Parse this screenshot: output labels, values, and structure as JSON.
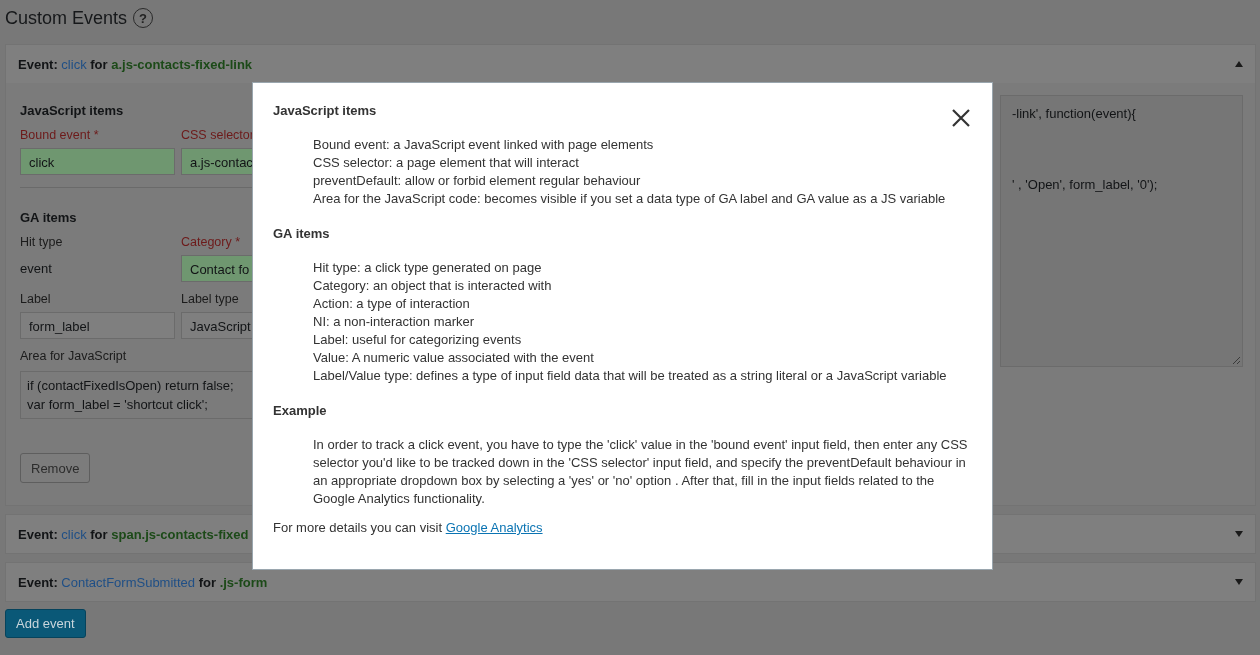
{
  "page_title": "Custom Events",
  "help_label": "?",
  "events": [
    {
      "prefix": "Event:",
      "event_type": "click",
      "joiner": "for",
      "selector": "a.js-contacts-fixed-link",
      "expanded": true,
      "body": {
        "js_section": {
          "heading": "JavaScript items",
          "fields": [
            {
              "label": "Bound event *",
              "required": true,
              "kind": "input",
              "value": "click",
              "valid": true
            },
            {
              "label": "CSS selector",
              "required": true,
              "kind": "input",
              "value": "a.js-contac",
              "valid": true
            }
          ]
        },
        "ga_section": {
          "heading": "GA items",
          "rows": [
            [
              {
                "label": "Hit type",
                "required": false,
                "kind": "text",
                "value": "event"
              },
              {
                "label": "Category *",
                "required": true,
                "kind": "input",
                "value": "Contact fo",
                "valid": true
              }
            ],
            [
              {
                "label": "Label",
                "required": false,
                "kind": "input",
                "value": "form_label",
                "valid": false
              },
              {
                "label": "Label type",
                "required": false,
                "kind": "input",
                "value": "JavaScript",
                "valid": false
              }
            ]
          ]
        },
        "code_area": {
          "label": "Area for JavaScript",
          "lines": [
            "if (contactFixedIsOpen) return false;",
            "var form_label = 'shortcut click';"
          ]
        },
        "remove_button": "Remove",
        "side_code": {
          "lines": [
            "-link', function(event){",
            "' , 'Open', form_label, '0');"
          ]
        }
      }
    },
    {
      "prefix": "Event:",
      "event_type": "click",
      "joiner": "for",
      "selector": "span.js-contacts-fixed",
      "expanded": false
    },
    {
      "prefix": "Event:",
      "event_type": "ContactFormSubmitted",
      "joiner": "for",
      "selector": ".js-form",
      "expanded": false
    }
  ],
  "add_button": "Add event",
  "help_modal": {
    "sections": [
      {
        "heading": "JavaScript items",
        "kind": "list",
        "lines": [
          "Bound event: a JavaScript event linked with page elements",
          "CSS selector: a page element that will interact",
          "preventDefault: allow or forbid element regular behaviour",
          "Area for the JavaScript code: becomes visible if you set a data type of GA label and GA value as a JS variable"
        ]
      },
      {
        "heading": "GA items",
        "kind": "list",
        "lines": [
          "Hit type: a click type generated on page",
          "Category: an object that is interacted with",
          "Action: a type of interaction",
          "NI: a non-interaction marker",
          "Label: useful for categorizing events",
          "Value: A numeric value associated with the event",
          "Label/Value type: defines a type of input field data that will be treated as a string literal or a JavaScript variable"
        ]
      },
      {
        "heading": "Example",
        "kind": "paragraph",
        "text": "In order to track a click event, you have to type the 'click' value in the 'bound event' input field, then enter any CSS selector you'd like to be tracked down in the 'CSS selector' input field, and specify the preventDefault behaviour in an appropriate dropdown box by selecting a 'yes' or 'no' option . After that, fill in the input fields related to the Google Analytics functionality."
      }
    ],
    "footer": {
      "text": "For more details you can visit",
      "link": "Google Analytics"
    }
  }
}
